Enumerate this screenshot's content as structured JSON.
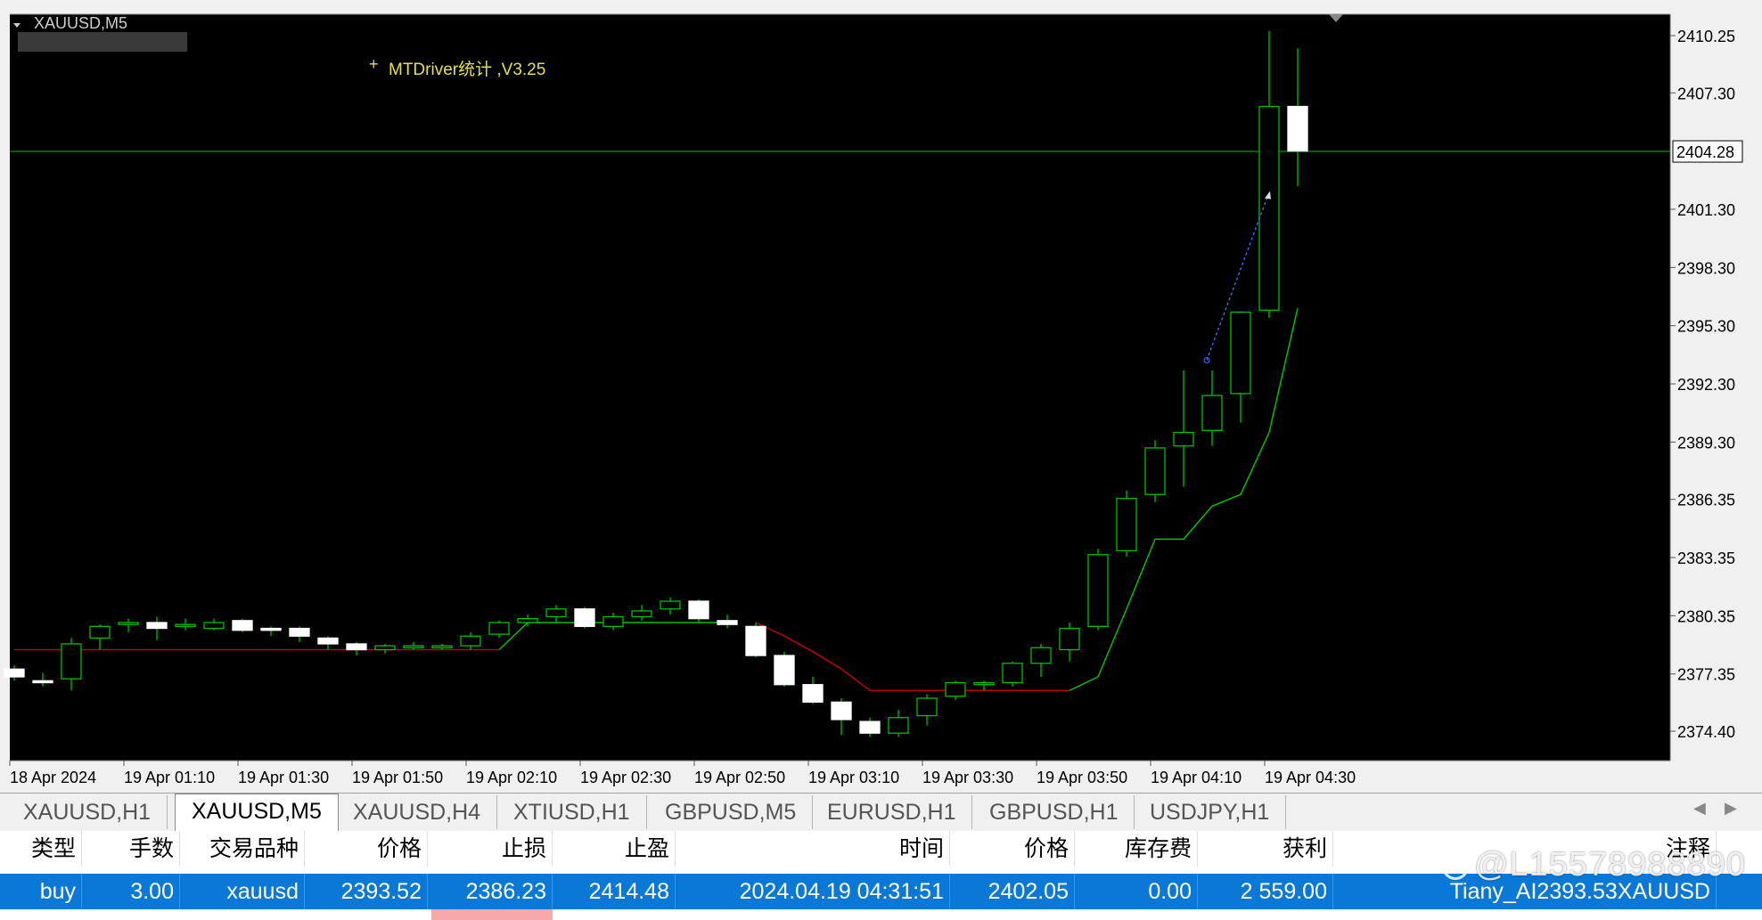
{
  "chart": {
    "window_title": "XAUUSD,M5",
    "indicator_label": "MTDriver统计 ,V3.25",
    "current_price_label": "2404.28",
    "price_axis": [
      "2410.25",
      "2407.30",
      "2404.28",
      "2401.30",
      "2398.30",
      "2395.30",
      "2392.30",
      "2389.30",
      "2386.35",
      "2383.35",
      "2380.35",
      "2377.35",
      "2374.40"
    ],
    "time_axis": [
      "18 Apr 2024",
      "19 Apr 01:10",
      "19 Apr 01:30",
      "19 Apr 01:50",
      "19 Apr 02:10",
      "19 Apr 02:30",
      "19 Apr 02:50",
      "19 Apr 03:10",
      "19 Apr 03:30",
      "19 Apr 03:50",
      "19 Apr 04:10",
      "19 Apr 04:30"
    ],
    "colors": {
      "background": "#000000",
      "bull_body": "#000000",
      "bear_body": "#ffffff",
      "wick": "#00c000",
      "trail_red": "#c00000",
      "trail_green": "#00c000",
      "price_line": "#00c000"
    }
  },
  "chart_data": {
    "type": "candlestick",
    "symbol": "XAUUSD",
    "timeframe": "M5",
    "ylim": [
      2373.0,
      2411.0
    ],
    "candles": [
      {
        "o": 2377.6,
        "h": 2377.8,
        "l": 2377.0,
        "c": 2377.2
      },
      {
        "o": 2377.0,
        "h": 2377.4,
        "l": 2376.7,
        "c": 2376.9
      },
      {
        "o": 2377.1,
        "h": 2379.2,
        "l": 2376.5,
        "c": 2378.9
      },
      {
        "o": 2379.2,
        "h": 2379.9,
        "l": 2378.6,
        "c": 2379.8
      },
      {
        "o": 2379.9,
        "h": 2380.2,
        "l": 2379.5,
        "c": 2380.0
      },
      {
        "o": 2380.0,
        "h": 2380.3,
        "l": 2379.1,
        "c": 2379.7
      },
      {
        "o": 2379.8,
        "h": 2380.2,
        "l": 2379.6,
        "c": 2379.9
      },
      {
        "o": 2379.7,
        "h": 2380.2,
        "l": 2379.6,
        "c": 2380.0
      },
      {
        "o": 2380.1,
        "h": 2380.2,
        "l": 2379.5,
        "c": 2379.6
      },
      {
        "o": 2379.7,
        "h": 2379.8,
        "l": 2379.3,
        "c": 2379.6
      },
      {
        "o": 2379.7,
        "h": 2379.8,
        "l": 2379.0,
        "c": 2379.3
      },
      {
        "o": 2379.2,
        "h": 2379.3,
        "l": 2378.6,
        "c": 2378.9
      },
      {
        "o": 2378.9,
        "h": 2379.0,
        "l": 2378.3,
        "c": 2378.6
      },
      {
        "o": 2378.6,
        "h": 2378.9,
        "l": 2378.4,
        "c": 2378.8
      },
      {
        "o": 2378.7,
        "h": 2379.0,
        "l": 2378.6,
        "c": 2378.8
      },
      {
        "o": 2378.7,
        "h": 2378.9,
        "l": 2378.6,
        "c": 2378.8
      },
      {
        "o": 2378.8,
        "h": 2379.5,
        "l": 2378.6,
        "c": 2379.3
      },
      {
        "o": 2379.4,
        "h": 2380.1,
        "l": 2379.2,
        "c": 2380.0
      },
      {
        "o": 2380.0,
        "h": 2380.4,
        "l": 2379.8,
        "c": 2380.2
      },
      {
        "o": 2380.3,
        "h": 2380.9,
        "l": 2380.0,
        "c": 2380.7
      },
      {
        "o": 2380.7,
        "h": 2380.8,
        "l": 2379.7,
        "c": 2379.8
      },
      {
        "o": 2379.8,
        "h": 2380.5,
        "l": 2379.6,
        "c": 2380.3
      },
      {
        "o": 2380.3,
        "h": 2380.9,
        "l": 2380.1,
        "c": 2380.6
      },
      {
        "o": 2380.7,
        "h": 2381.3,
        "l": 2380.4,
        "c": 2381.1
      },
      {
        "o": 2381.1,
        "h": 2381.2,
        "l": 2380.0,
        "c": 2380.2
      },
      {
        "o": 2380.1,
        "h": 2380.4,
        "l": 2379.7,
        "c": 2379.9
      },
      {
        "o": 2379.8,
        "h": 2380.0,
        "l": 2378.2,
        "c": 2378.3
      },
      {
        "o": 2378.3,
        "h": 2378.5,
        "l": 2376.7,
        "c": 2376.8
      },
      {
        "o": 2376.8,
        "h": 2377.2,
        "l": 2375.8,
        "c": 2375.9
      },
      {
        "o": 2375.9,
        "h": 2376.1,
        "l": 2374.2,
        "c": 2375.0
      },
      {
        "o": 2374.9,
        "h": 2375.1,
        "l": 2374.1,
        "c": 2374.3
      },
      {
        "o": 2374.3,
        "h": 2375.5,
        "l": 2374.1,
        "c": 2375.1
      },
      {
        "o": 2375.2,
        "h": 2376.3,
        "l": 2374.7,
        "c": 2376.1
      },
      {
        "o": 2376.2,
        "h": 2377.0,
        "l": 2376.0,
        "c": 2376.9
      },
      {
        "o": 2376.8,
        "h": 2377.0,
        "l": 2376.5,
        "c": 2376.9
      },
      {
        "o": 2376.9,
        "h": 2378.0,
        "l": 2376.7,
        "c": 2377.9
      },
      {
        "o": 2377.9,
        "h": 2378.9,
        "l": 2377.2,
        "c": 2378.7
      },
      {
        "o": 2378.6,
        "h": 2380.0,
        "l": 2378.0,
        "c": 2379.7
      },
      {
        "o": 2379.8,
        "h": 2383.8,
        "l": 2379.6,
        "c": 2383.5
      },
      {
        "o": 2383.7,
        "h": 2386.8,
        "l": 2383.4,
        "c": 2386.4
      },
      {
        "o": 2386.6,
        "h": 2389.4,
        "l": 2386.2,
        "c": 2389.0
      },
      {
        "o": 2389.1,
        "h": 2393.0,
        "l": 2387.0,
        "c": 2389.8
      },
      {
        "o": 2389.9,
        "h": 2393.0,
        "l": 2389.1,
        "c": 2391.7
      },
      {
        "o": 2391.8,
        "h": 2395.8,
        "l": 2390.3,
        "c": 2396.0
      },
      {
        "o": 2396.1,
        "h": 2410.5,
        "l": 2395.7,
        "c": 2406.6
      },
      {
        "o": 2406.6,
        "h": 2409.6,
        "l": 2402.5,
        "c": 2404.3
      }
    ],
    "trailing_stop_red": [
      2378.6,
      2378.6,
      2378.6,
      2378.6,
      2378.6,
      2378.6,
      2378.6,
      2378.6,
      2378.6,
      2378.6,
      2378.6,
      2378.6,
      2378.6,
      2378.6,
      2378.6,
      2378.6,
      2378.6,
      2378.6,
      null,
      null,
      null,
      null,
      null,
      null,
      null,
      null,
      2380.0,
      2379.3,
      2378.5,
      2377.6,
      2376.5,
      2376.5,
      2376.5,
      2376.5,
      2376.5,
      2376.5,
      2376.5,
      2376.5,
      null,
      null,
      null,
      null,
      null,
      null,
      null,
      null
    ],
    "trailing_stop_green": [
      null,
      null,
      null,
      null,
      null,
      null,
      null,
      null,
      null,
      null,
      null,
      null,
      null,
      null,
      null,
      null,
      null,
      2378.6,
      2380.0,
      2380.0,
      2380.0,
      2380.0,
      2380.0,
      2380.0,
      2380.0,
      2380.0,
      null,
      null,
      null,
      null,
      null,
      null,
      null,
      null,
      null,
      null,
      null,
      2376.5,
      2377.2,
      2380.7,
      2384.3,
      2384.3,
      2386.0,
      2386.6,
      2389.8,
      2396.2
    ],
    "current_price": 2404.28
  },
  "tabs": [
    {
      "label": "XAUUSD,H1",
      "active": false
    },
    {
      "label": "XAUUSD,M5",
      "active": true
    },
    {
      "label": "XAUUSD,H4",
      "active": false
    },
    {
      "label": "XTIUSD,H1",
      "active": false
    },
    {
      "label": "GBPUSD,M5",
      "active": false
    },
    {
      "label": "EURUSD,H1",
      "active": false
    },
    {
      "label": "GBPUSD,H1",
      "active": false
    },
    {
      "label": "USDJPY,H1",
      "active": false
    }
  ],
  "orders": {
    "headers": [
      "类型",
      "手数",
      "交易品种",
      "价格",
      "止损",
      "止盈",
      "时间",
      "价格",
      "库存费",
      "获利",
      "注释"
    ],
    "rows": [
      [
        "buy",
        "3.00",
        "xauusd",
        "2393.52",
        "2386.23",
        "2414.48",
        "2024.04.19 04:31:51",
        "2402.05",
        "0.00",
        "2 559.00",
        "Tiany_AI2393.53XAUUSD"
      ]
    ]
  },
  "watermark": "@L15578988890"
}
